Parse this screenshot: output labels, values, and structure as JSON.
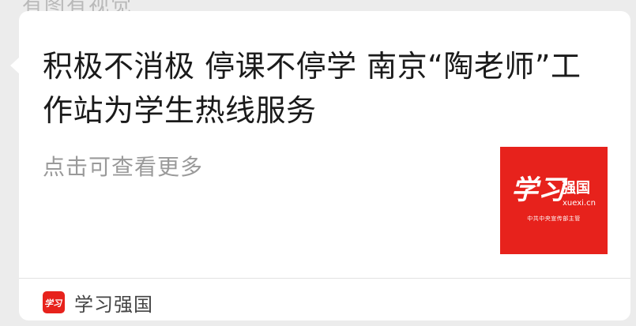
{
  "header_partial": "有图有视觉",
  "article": {
    "title": "积极不消极 停课不停学 南京“陶老师”工作站为学生热线服务",
    "subtitle": "点击可查看更多",
    "thumbnail": {
      "logo_script": "学习",
      "logo_text": "强国",
      "domain": "xuexi.cn",
      "tagline": "中共中央宣传部主管"
    }
  },
  "source": {
    "name": "学习强国",
    "icon": "xuexi-logo-icon",
    "icon_glyph": "学习"
  },
  "colors": {
    "brand_red": "#e7221c",
    "title": "#1a1a1a",
    "subtitle": "#9a9a9a",
    "background": "#ececec",
    "card": "#ffffff"
  }
}
